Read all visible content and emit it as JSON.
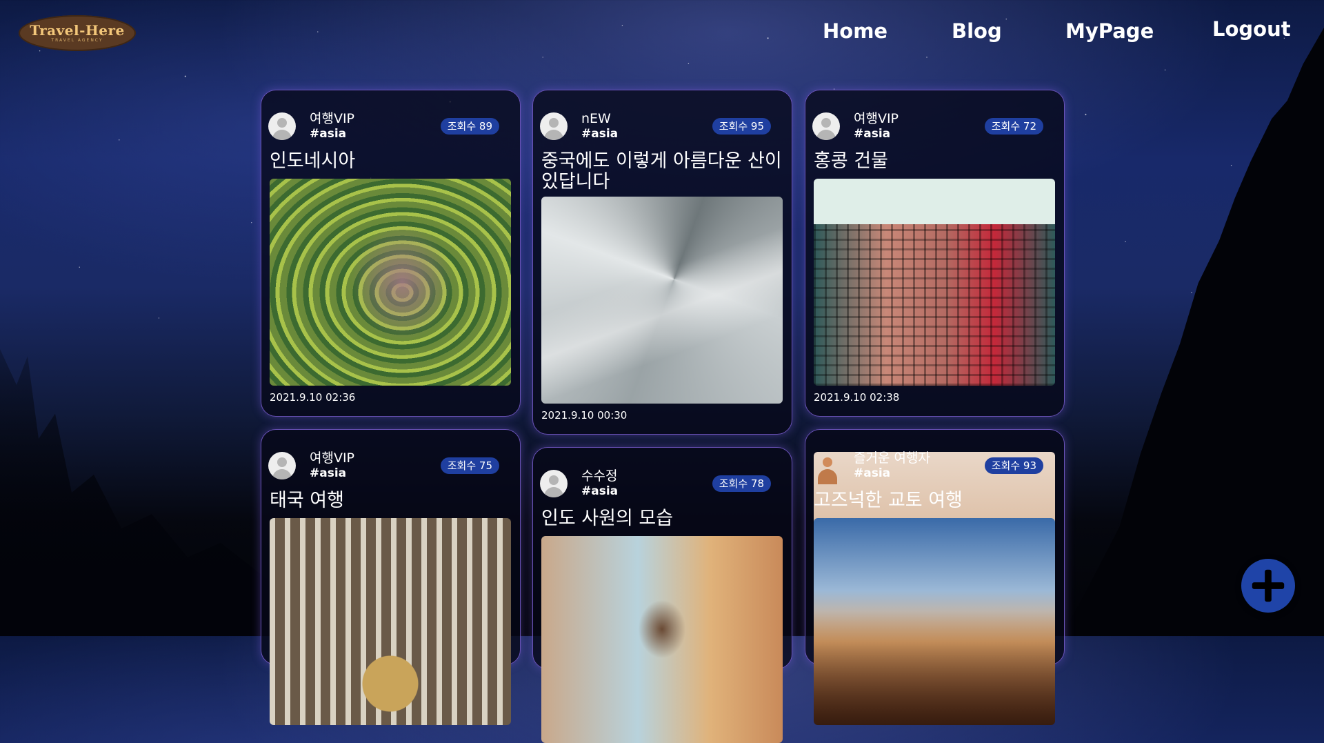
{
  "logo": {
    "main": "Travel-Here",
    "sub": "TRAVEL AGENCY"
  },
  "nav": {
    "home": "Home",
    "blog": "Blog",
    "mypage": "MyPage",
    "logout": "Logout"
  },
  "posts": [
    {
      "author": "여행VIP",
      "tag": "#asia",
      "views": "조회수 89",
      "title": "인도네시아",
      "date": "2021.9.10 02:36",
      "image": "rice-terraces"
    },
    {
      "author": "nEW",
      "tag": "#asia",
      "views": "조회수 95",
      "title": "중국에도 이렇게 아름다운 산이 있답니다",
      "date": "2021.9.10 00:30",
      "image": "snowy-mountain"
    },
    {
      "author": "여행VIP",
      "tag": "#asia",
      "views": "조회수 72",
      "title": "홍콩 건물",
      "date": "2021.9.10 02:38",
      "image": "hong-kong-building"
    },
    {
      "author": "여행VIP",
      "tag": "#asia",
      "views": "조회수 75",
      "title": "태국 여행",
      "date": "",
      "image": "thai-market"
    },
    {
      "author": "수수정",
      "tag": "#asia",
      "views": "조회수 78",
      "title": "인도 사원의 모습",
      "date": "",
      "image": "india-temple"
    },
    {
      "author": "즐거운 여행자",
      "tag": "#asia",
      "views": "조회수 93",
      "title": "고즈넉한 교토 여행",
      "date": "",
      "image": "kyoto-pagoda"
    }
  ],
  "fab": {
    "icon": "plus-icon"
  },
  "colors": {
    "badge": "#1f3fa0",
    "card_border": "#6a52b8",
    "fab": "#1f44a8"
  }
}
